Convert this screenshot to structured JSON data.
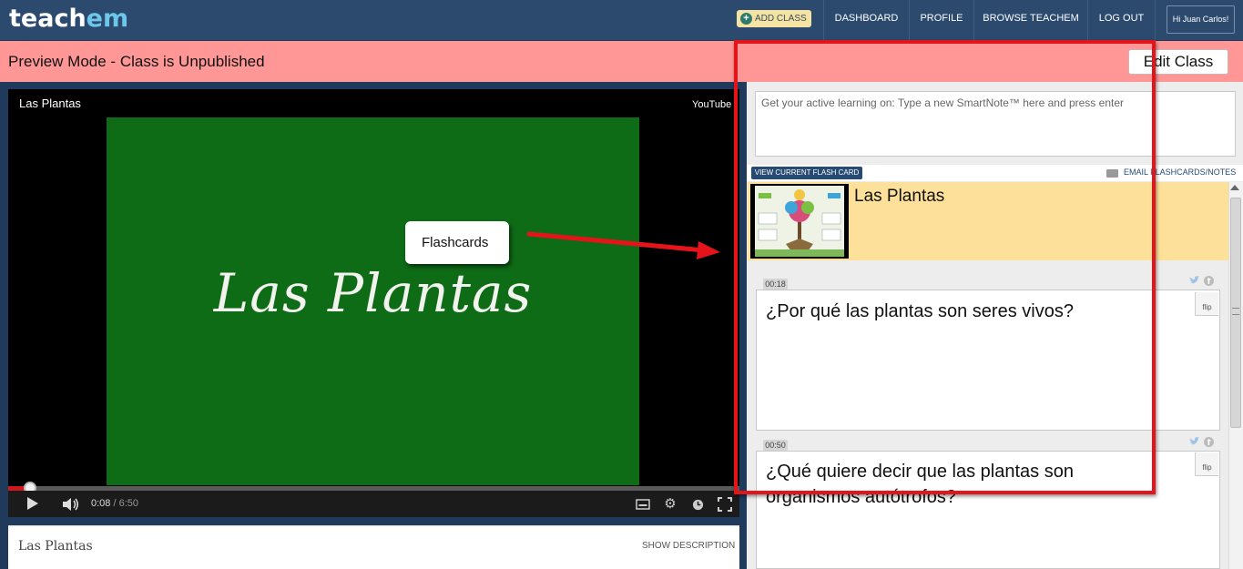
{
  "colors": {
    "nav_bg": "#2b4a6e",
    "banner_bg": "#ff9797",
    "video_green": "#0e6b16",
    "card_highlight": "#fde19a",
    "annotation_red": "#e5141b",
    "logo_accent": "#6cc7ea"
  },
  "nav": {
    "logo_part1": "teach",
    "logo_part2": "em",
    "add_class": "ADD CLASS",
    "items": [
      "DASHBOARD",
      "PROFILE",
      "BROWSE TEACHEM",
      "LOG OUT"
    ],
    "greeting": "Hi Juan Carlos!"
  },
  "banner": {
    "text": "Preview Mode - Class is Unpublished",
    "edit_button": "Edit Class"
  },
  "video": {
    "title": "Las Plantas",
    "brand": "YouTube",
    "slide_title": "Las Plantas",
    "current_time": "0:08",
    "separator": " / ",
    "duration": "6:50",
    "progress_fraction": 0.02
  },
  "description": {
    "title": "Las Plantas",
    "show_label": "SHOW DESCRIPTION"
  },
  "notes": {
    "placeholder": "Get your active learning on: Type a new SmartNote™ here and press enter",
    "view_current": "VIEW CURRENT FLASH CARD",
    "email_label": "EMAIL FLASHCARDS/NOTES",
    "header_title": "Las Plantas",
    "flip_label": "flip",
    "cards": [
      {
        "time": "00:18",
        "question": "¿Por qué las plantas son seres vivos?"
      },
      {
        "time": "00:50",
        "question": "¿Qué quiere decir que las plantas son organismos autótrofos?"
      }
    ]
  },
  "annotation": {
    "callout": "Flashcards"
  },
  "icons": {
    "add": "plus-circle-icon",
    "play": "play-icon",
    "volume": "volume-icon",
    "captions": "captions-icon",
    "settings": "gear-icon",
    "watch_later": "clock-icon",
    "fullscreen": "fullscreen-icon",
    "email": "envelope-icon",
    "twitter": "twitter-icon",
    "facebook": "facebook-icon"
  }
}
